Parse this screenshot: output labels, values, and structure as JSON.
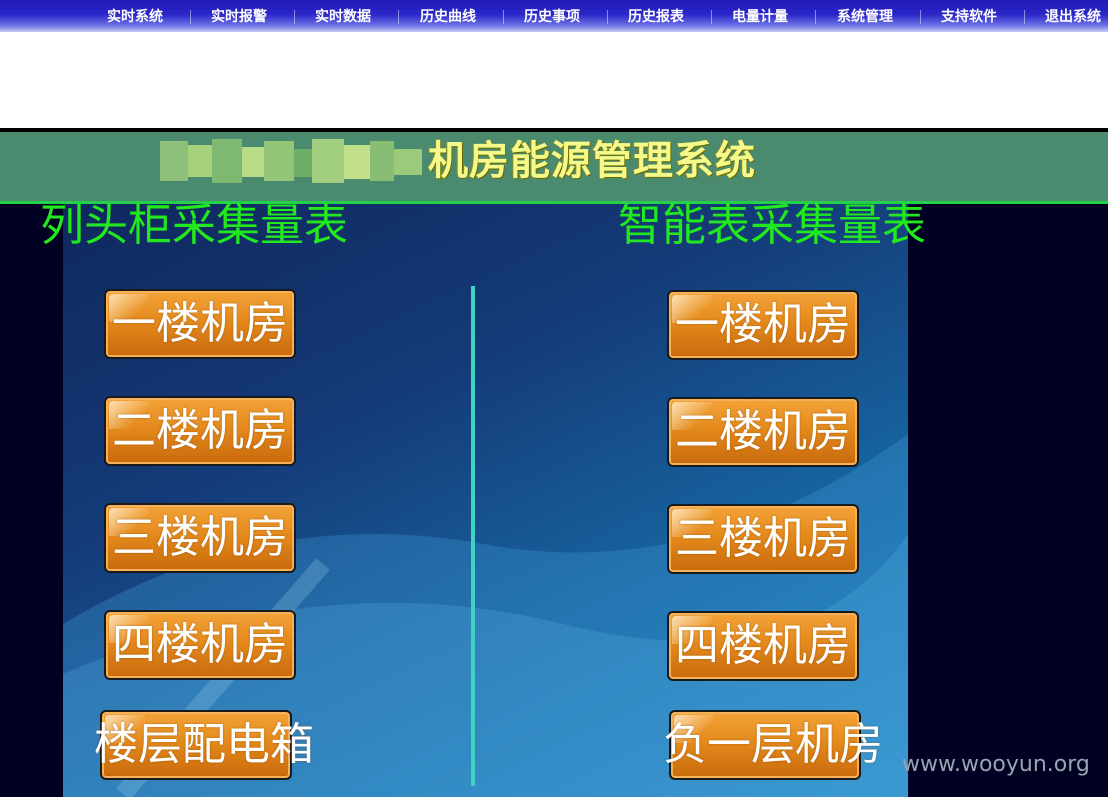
{
  "nav": {
    "items": [
      {
        "label": "实时系统"
      },
      {
        "label": "实时报警"
      },
      {
        "label": "实时数据"
      },
      {
        "label": "历史曲线"
      },
      {
        "label": "历史事项"
      },
      {
        "label": "历史报表"
      },
      {
        "label": "电量计量"
      },
      {
        "label": "系统管理"
      },
      {
        "label": "支持软件"
      },
      {
        "label": "退出系统"
      }
    ]
  },
  "banner": {
    "title": "机房能源管理系统"
  },
  "left_column": {
    "heading": "列头柜采集量表",
    "buttons": [
      {
        "label": "一楼机房"
      },
      {
        "label": "二楼机房"
      },
      {
        "label": "三楼机房"
      },
      {
        "label": "四楼机房"
      },
      {
        "label": "楼层配电箱"
      }
    ]
  },
  "right_column": {
    "heading": "智能表采集量表",
    "buttons": [
      {
        "label": "一楼机房"
      },
      {
        "label": "二楼机房"
      },
      {
        "label": "三楼机房"
      },
      {
        "label": "四楼机房"
      },
      {
        "label": "负一层机房"
      }
    ]
  },
  "watermark": "www.wooyun.org",
  "colors": {
    "nav_bg": "#2a26c8",
    "banner_bg": "#4a8a6e",
    "banner_title": "#f4f98a",
    "heading_green": "#22e81e",
    "button_orange": "#e48a1c",
    "divider": "#3fd4c0"
  }
}
